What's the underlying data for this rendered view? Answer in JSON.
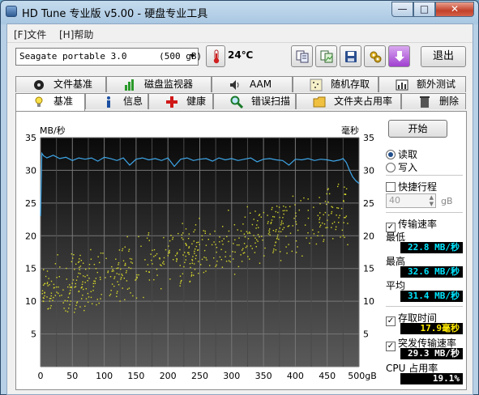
{
  "window": {
    "title": "HD Tune 专业版 v5.00 - 硬盘专业工具",
    "min_glyph": "—",
    "max_glyph": "□",
    "close_glyph": "✕"
  },
  "menu": [
    "[F]文件",
    "[H]帮助"
  ],
  "toolbar": {
    "drive": "Seagate portable 3.0      (500 gB)",
    "temperature": "24℃",
    "exit_label": "退出",
    "icons": [
      "thermometer-icon",
      "copy-text-icon",
      "copy-screenshot-icon",
      "save-icon",
      "options-icon",
      "download-icon"
    ]
  },
  "tabs_row1": [
    {
      "label": "文件基准",
      "icon": "file-benchmark-icon"
    },
    {
      "label": "磁盘监视器",
      "icon": "disk-monitor-icon"
    },
    {
      "label": "AAM",
      "icon": "speaker-icon"
    },
    {
      "label": "随机存取",
      "icon": "random-access-icon"
    },
    {
      "label": "额外测试",
      "icon": "extra-tests-icon"
    }
  ],
  "tabs_row2": [
    {
      "label": "基准",
      "icon": "benchmark-icon"
    },
    {
      "label": "信息",
      "icon": "info-icon"
    },
    {
      "label": "健康",
      "icon": "health-icon"
    },
    {
      "label": "错误扫描",
      "icon": "error-scan-icon"
    },
    {
      "label": "文件夹占用率",
      "icon": "folder-usage-icon"
    },
    {
      "label": "删除",
      "icon": "erase-icon"
    }
  ],
  "active_tab": "基准",
  "controls": {
    "start_label": "开始",
    "read_label": "读取",
    "write_label": "写入",
    "mode": "read",
    "quick_label": "快捷行程",
    "quick_checked": false,
    "quick_value": "40",
    "quick_unit": "gB",
    "transfer_label": "传输速率",
    "transfer_checked": true,
    "min_label": "最低",
    "min_value": "22.8 MB/秒",
    "max_label": "最高",
    "max_value": "32.6 MB/秒",
    "avg_label": "平均",
    "avg_value": "31.4 MB/秒",
    "access_label": "存取时间",
    "access_checked": true,
    "access_value": "17.9毫秒",
    "burst_label": "突发传输速率",
    "burst_checked": true,
    "burst_value": "29.3 MB/秒",
    "cpu_label": "CPU 占用率",
    "cpu_value": "19.1%"
  },
  "chart_data": {
    "type": "line",
    "left_axis_label": "MB/秒",
    "right_axis_label": "毫秒",
    "xlabel_unit": "gB",
    "x_ticks": [
      "0",
      "50",
      "100",
      "150",
      "200",
      "250",
      "300",
      "350",
      "400",
      "450",
      "500gB"
    ],
    "y_ticks": [
      "5",
      "10",
      "15",
      "20",
      "25",
      "30",
      "35"
    ],
    "xlim": [
      0,
      500
    ],
    "ylim": [
      0,
      35
    ],
    "grid": true,
    "series": [
      {
        "color": "#3ea6e8",
        "x": [
          0,
          2,
          5,
          10,
          20,
          30,
          40,
          50,
          60,
          70,
          80,
          90,
          100,
          110,
          120,
          130,
          140,
          150,
          160,
          170,
          180,
          190,
          200,
          210,
          220,
          230,
          240,
          250,
          260,
          270,
          280,
          290,
          300,
          310,
          320,
          330,
          340,
          350,
          360,
          370,
          380,
          390,
          400,
          410,
          420,
          430,
          440,
          450,
          460,
          470,
          475,
          480,
          485,
          490,
          495,
          500
        ],
        "y": [
          23,
          32.6,
          32.2,
          31.9,
          32.3,
          31.8,
          32.0,
          31.5,
          31.9,
          31.7,
          31.9,
          31.4,
          32.0,
          31.8,
          31.5,
          31.9,
          30.8,
          31.7,
          31.9,
          31.6,
          31.8,
          31.5,
          31.9,
          30.6,
          31.7,
          31.9,
          31.5,
          31.7,
          31.8,
          31.4,
          31.9,
          31.6,
          31.8,
          31.5,
          31.7,
          31.9,
          31.3,
          31.7,
          31.8,
          31.6,
          31.5,
          30.8,
          31.7,
          31.6,
          31.8,
          31.5,
          31.7,
          31.6,
          31.4,
          31.6,
          31.8,
          31.2,
          30.0,
          29.0,
          28.4,
          28.0
        ]
      }
    ],
    "access_scatter": {
      "color": "#d8d82a",
      "trend_start_ms": 11,
      "trend_end_ms": 24,
      "spread_ms": 5.5
    }
  }
}
